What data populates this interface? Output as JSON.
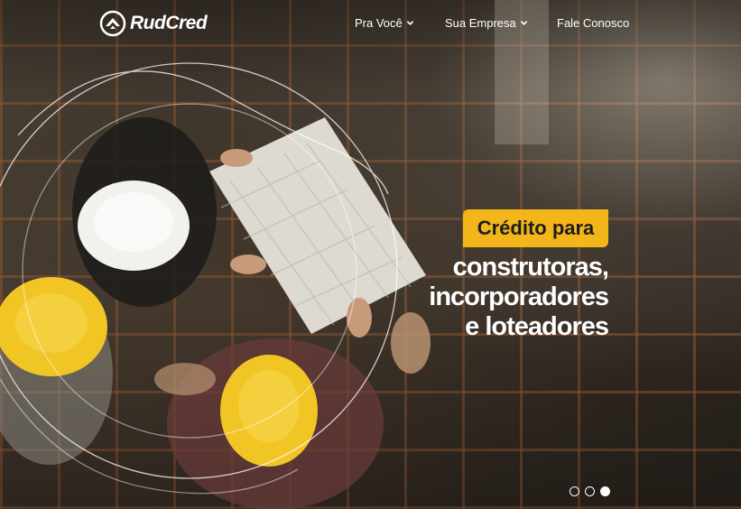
{
  "brand": {
    "name": "RudCred",
    "logo_icon": "rudcred-logo-icon"
  },
  "nav": {
    "items": [
      {
        "label": "Pra Você",
        "icon": "chevron-down-icon"
      },
      {
        "label": "Sua Empresa",
        "icon": "chevron-down-icon"
      },
      {
        "label": "Fale Conosco"
      }
    ]
  },
  "hero": {
    "tag": "Crédito para",
    "headline_lines": [
      "construtoras,",
      "incorporadores",
      "e loteadores"
    ],
    "image_description_icon": "construction-workers-image"
  },
  "carousel": {
    "slides_count": 3,
    "active_slide": 3
  },
  "colors": {
    "accent": "#f2b61a",
    "text_on_accent": "#1d1d1b",
    "nav_text": "#ffffff"
  }
}
